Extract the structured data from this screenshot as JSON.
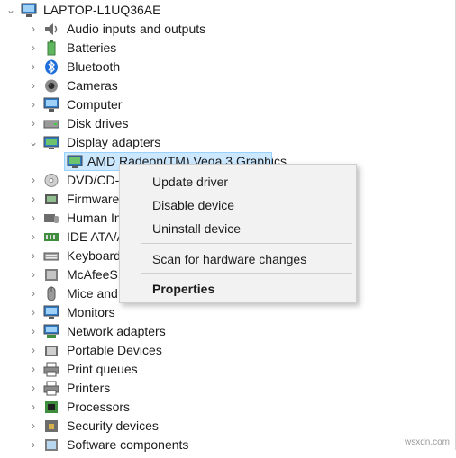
{
  "tree": {
    "root": {
      "label": "LAPTOP-L1UQ36AE",
      "chevron": "⌄",
      "icon": "computer-icon"
    },
    "items": [
      {
        "label": "Audio inputs and outputs",
        "chevron": "›",
        "icon": "speaker-icon"
      },
      {
        "label": "Batteries",
        "chevron": "›",
        "icon": "battery-icon"
      },
      {
        "label": "Bluetooth",
        "chevron": "›",
        "icon": "bluetooth-icon"
      },
      {
        "label": "Cameras",
        "chevron": "›",
        "icon": "camera-icon"
      },
      {
        "label": "Computer",
        "chevron": "›",
        "icon": "computer-icon"
      },
      {
        "label": "Disk drives",
        "chevron": "›",
        "icon": "disk-drive-icon"
      },
      {
        "label": "Display adapters",
        "chevron": "⌄",
        "icon": "display-adapter-icon"
      },
      {
        "label": "DVD/CD-",
        "chevron": "›",
        "icon": "dvd-icon"
      },
      {
        "label": "Firmware",
        "chevron": "›",
        "icon": "firmware-icon"
      },
      {
        "label": "Human In",
        "chevron": "›",
        "icon": "hid-icon"
      },
      {
        "label": "IDE ATA/A",
        "chevron": "›",
        "icon": "ide-icon"
      },
      {
        "label": "Keyboard",
        "chevron": "›",
        "icon": "keyboard-icon"
      },
      {
        "label": "McAfeeS",
        "chevron": "›",
        "icon": "mcafee-icon"
      },
      {
        "label": "Mice and",
        "chevron": "›",
        "icon": "mouse-icon"
      },
      {
        "label": "Monitors",
        "chevron": "›",
        "icon": "monitor-icon"
      },
      {
        "label": "Network adapters",
        "chevron": "›",
        "icon": "network-adapter-icon"
      },
      {
        "label": "Portable Devices",
        "chevron": "›",
        "icon": "portable-device-icon"
      },
      {
        "label": "Print queues",
        "chevron": "›",
        "icon": "printer-icon"
      },
      {
        "label": "Printers",
        "chevron": "›",
        "icon": "printer-icon"
      },
      {
        "label": "Processors",
        "chevron": "›",
        "icon": "processor-icon"
      },
      {
        "label": "Security devices",
        "chevron": "›",
        "icon": "security-device-icon"
      },
      {
        "label": "Software components",
        "chevron": "›",
        "icon": "software-component-icon"
      }
    ],
    "display_child": {
      "label": "AMD Radeon(TM) Vega 3 Graphics",
      "icon": "display-adapter-icon"
    }
  },
  "context_menu": {
    "update_driver": "Update driver",
    "disable_device": "Disable device",
    "uninstall_device": "Uninstall device",
    "scan": "Scan for hardware changes",
    "properties": "Properties"
  },
  "watermark": "wsxdn.com",
  "colors": {
    "selection_bg": "#cce8ff",
    "selection_border": "#99d1ff",
    "menu_bg": "#f2f2f2"
  }
}
